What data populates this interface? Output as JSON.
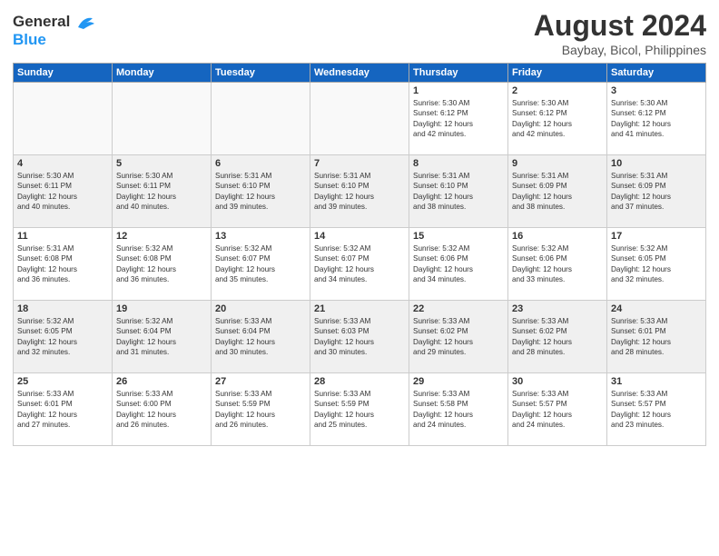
{
  "header": {
    "logo_line1": "General",
    "logo_line2": "Blue",
    "title": "August 2024",
    "subtitle": "Baybay, Bicol, Philippines"
  },
  "days_of_week": [
    "Sunday",
    "Monday",
    "Tuesday",
    "Wednesday",
    "Thursday",
    "Friday",
    "Saturday"
  ],
  "weeks": [
    [
      {
        "num": "",
        "text": "",
        "empty": true
      },
      {
        "num": "",
        "text": "",
        "empty": true
      },
      {
        "num": "",
        "text": "",
        "empty": true
      },
      {
        "num": "",
        "text": "",
        "empty": true
      },
      {
        "num": "1",
        "text": "Sunrise: 5:30 AM\nSunset: 6:12 PM\nDaylight: 12 hours\nand 42 minutes.",
        "empty": false
      },
      {
        "num": "2",
        "text": "Sunrise: 5:30 AM\nSunset: 6:12 PM\nDaylight: 12 hours\nand 42 minutes.",
        "empty": false
      },
      {
        "num": "3",
        "text": "Sunrise: 5:30 AM\nSunset: 6:12 PM\nDaylight: 12 hours\nand 41 minutes.",
        "empty": false
      }
    ],
    [
      {
        "num": "4",
        "text": "Sunrise: 5:30 AM\nSunset: 6:11 PM\nDaylight: 12 hours\nand 40 minutes.",
        "empty": false
      },
      {
        "num": "5",
        "text": "Sunrise: 5:30 AM\nSunset: 6:11 PM\nDaylight: 12 hours\nand 40 minutes.",
        "empty": false
      },
      {
        "num": "6",
        "text": "Sunrise: 5:31 AM\nSunset: 6:10 PM\nDaylight: 12 hours\nand 39 minutes.",
        "empty": false
      },
      {
        "num": "7",
        "text": "Sunrise: 5:31 AM\nSunset: 6:10 PM\nDaylight: 12 hours\nand 39 minutes.",
        "empty": false
      },
      {
        "num": "8",
        "text": "Sunrise: 5:31 AM\nSunset: 6:10 PM\nDaylight: 12 hours\nand 38 minutes.",
        "empty": false
      },
      {
        "num": "9",
        "text": "Sunrise: 5:31 AM\nSunset: 6:09 PM\nDaylight: 12 hours\nand 38 minutes.",
        "empty": false
      },
      {
        "num": "10",
        "text": "Sunrise: 5:31 AM\nSunset: 6:09 PM\nDaylight: 12 hours\nand 37 minutes.",
        "empty": false
      }
    ],
    [
      {
        "num": "11",
        "text": "Sunrise: 5:31 AM\nSunset: 6:08 PM\nDaylight: 12 hours\nand 36 minutes.",
        "empty": false
      },
      {
        "num": "12",
        "text": "Sunrise: 5:32 AM\nSunset: 6:08 PM\nDaylight: 12 hours\nand 36 minutes.",
        "empty": false
      },
      {
        "num": "13",
        "text": "Sunrise: 5:32 AM\nSunset: 6:07 PM\nDaylight: 12 hours\nand 35 minutes.",
        "empty": false
      },
      {
        "num": "14",
        "text": "Sunrise: 5:32 AM\nSunset: 6:07 PM\nDaylight: 12 hours\nand 34 minutes.",
        "empty": false
      },
      {
        "num": "15",
        "text": "Sunrise: 5:32 AM\nSunset: 6:06 PM\nDaylight: 12 hours\nand 34 minutes.",
        "empty": false
      },
      {
        "num": "16",
        "text": "Sunrise: 5:32 AM\nSunset: 6:06 PM\nDaylight: 12 hours\nand 33 minutes.",
        "empty": false
      },
      {
        "num": "17",
        "text": "Sunrise: 5:32 AM\nSunset: 6:05 PM\nDaylight: 12 hours\nand 32 minutes.",
        "empty": false
      }
    ],
    [
      {
        "num": "18",
        "text": "Sunrise: 5:32 AM\nSunset: 6:05 PM\nDaylight: 12 hours\nand 32 minutes.",
        "empty": false
      },
      {
        "num": "19",
        "text": "Sunrise: 5:32 AM\nSunset: 6:04 PM\nDaylight: 12 hours\nand 31 minutes.",
        "empty": false
      },
      {
        "num": "20",
        "text": "Sunrise: 5:33 AM\nSunset: 6:04 PM\nDaylight: 12 hours\nand 30 minutes.",
        "empty": false
      },
      {
        "num": "21",
        "text": "Sunrise: 5:33 AM\nSunset: 6:03 PM\nDaylight: 12 hours\nand 30 minutes.",
        "empty": false
      },
      {
        "num": "22",
        "text": "Sunrise: 5:33 AM\nSunset: 6:02 PM\nDaylight: 12 hours\nand 29 minutes.",
        "empty": false
      },
      {
        "num": "23",
        "text": "Sunrise: 5:33 AM\nSunset: 6:02 PM\nDaylight: 12 hours\nand 28 minutes.",
        "empty": false
      },
      {
        "num": "24",
        "text": "Sunrise: 5:33 AM\nSunset: 6:01 PM\nDaylight: 12 hours\nand 28 minutes.",
        "empty": false
      }
    ],
    [
      {
        "num": "25",
        "text": "Sunrise: 5:33 AM\nSunset: 6:01 PM\nDaylight: 12 hours\nand 27 minutes.",
        "empty": false
      },
      {
        "num": "26",
        "text": "Sunrise: 5:33 AM\nSunset: 6:00 PM\nDaylight: 12 hours\nand 26 minutes.",
        "empty": false
      },
      {
        "num": "27",
        "text": "Sunrise: 5:33 AM\nSunset: 5:59 PM\nDaylight: 12 hours\nand 26 minutes.",
        "empty": false
      },
      {
        "num": "28",
        "text": "Sunrise: 5:33 AM\nSunset: 5:59 PM\nDaylight: 12 hours\nand 25 minutes.",
        "empty": false
      },
      {
        "num": "29",
        "text": "Sunrise: 5:33 AM\nSunset: 5:58 PM\nDaylight: 12 hours\nand 24 minutes.",
        "empty": false
      },
      {
        "num": "30",
        "text": "Sunrise: 5:33 AM\nSunset: 5:57 PM\nDaylight: 12 hours\nand 24 minutes.",
        "empty": false
      },
      {
        "num": "31",
        "text": "Sunrise: 5:33 AM\nSunset: 5:57 PM\nDaylight: 12 hours\nand 23 minutes.",
        "empty": false
      }
    ]
  ]
}
